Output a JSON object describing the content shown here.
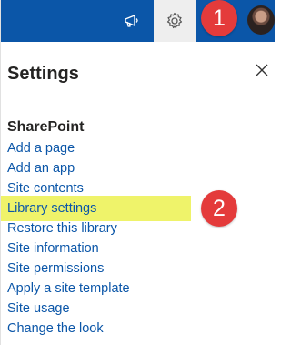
{
  "topbar": {
    "background_color": "#0b56a8",
    "icons": [
      "megaphone-icon",
      "gear-icon"
    ]
  },
  "annotations": {
    "badge_1": "1",
    "badge_2": "2",
    "badge_color": "#e43b3b"
  },
  "panel": {
    "title": "Settings",
    "close_icon": "close-icon",
    "section_heading": "SharePoint",
    "link_color": "#0b56a8",
    "highlight_color": "#eff36a",
    "items": [
      {
        "label": "Add a page"
      },
      {
        "label": "Add an app"
      },
      {
        "label": "Site contents"
      },
      {
        "label": "Library settings",
        "highlighted": true
      },
      {
        "label": "Restore this library"
      },
      {
        "label": "Site information"
      },
      {
        "label": "Site permissions"
      },
      {
        "label": "Apply a site template"
      },
      {
        "label": "Site usage"
      },
      {
        "label": "Change the look"
      }
    ]
  }
}
